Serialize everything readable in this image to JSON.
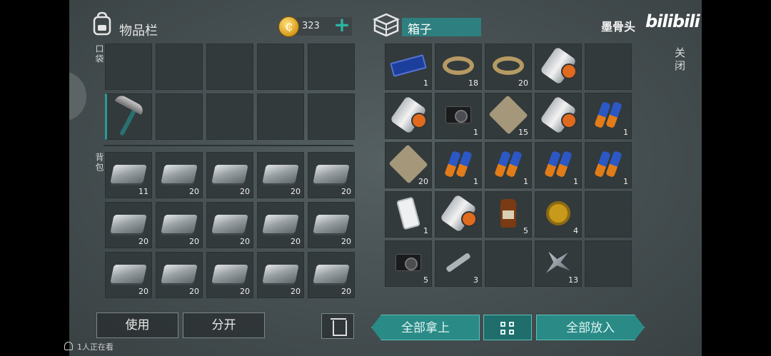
{
  "inventory": {
    "title": "物品栏",
    "coins": "323",
    "pocket_label": "口袋",
    "backpack_label": "背包",
    "pocket": [
      {
        "item": "",
        "count": ""
      },
      {
        "item": "",
        "count": ""
      },
      {
        "item": "",
        "count": ""
      },
      {
        "item": "",
        "count": ""
      },
      {
        "item": "",
        "count": ""
      },
      {
        "item": "pickaxe-icon",
        "count": ""
      },
      {
        "item": "",
        "count": ""
      },
      {
        "item": "",
        "count": ""
      },
      {
        "item": "",
        "count": ""
      },
      {
        "item": "",
        "count": ""
      }
    ],
    "backpack": [
      {
        "item": "iron-ingot-icon",
        "count": "11"
      },
      {
        "item": "iron-ingot-icon",
        "count": "20"
      },
      {
        "item": "iron-ingot-icon",
        "count": "20"
      },
      {
        "item": "iron-ingot-icon",
        "count": "20"
      },
      {
        "item": "iron-ingot-icon",
        "count": "20"
      },
      {
        "item": "iron-ingot-icon",
        "count": "20"
      },
      {
        "item": "iron-ingot-icon",
        "count": "20"
      },
      {
        "item": "iron-ingot-icon",
        "count": "20"
      },
      {
        "item": "iron-ingot-icon",
        "count": "20"
      },
      {
        "item": "iron-ingot-icon",
        "count": "20"
      },
      {
        "item": "iron-ingot-icon",
        "count": "20"
      },
      {
        "item": "iron-ingot-icon",
        "count": "20"
      },
      {
        "item": "iron-ingot-icon",
        "count": "20"
      },
      {
        "item": "iron-ingot-icon",
        "count": "20"
      },
      {
        "item": "iron-ingot-icon",
        "count": "20"
      }
    ]
  },
  "box": {
    "title": "箱子",
    "close_label": "关闭",
    "slots": [
      {
        "item": "circuit-board-icon",
        "count": "1"
      },
      {
        "item": "rope-icon",
        "count": "18"
      },
      {
        "item": "rope-icon",
        "count": "20"
      },
      {
        "item": "blueprint-tube-icon",
        "count": ""
      },
      {
        "item": "",
        "count": ""
      },
      {
        "item": "blueprint-tube-icon",
        "count": ""
      },
      {
        "item": "camera-icon",
        "count": "1"
      },
      {
        "item": "cloth-icon",
        "count": "15"
      },
      {
        "item": "blueprint-tube-icon",
        "count": ""
      },
      {
        "item": "battery-icon",
        "count": "1"
      },
      {
        "item": "cloth-icon",
        "count": "20"
      },
      {
        "item": "battery-icon",
        "count": "1"
      },
      {
        "item": "battery-icon",
        "count": "1"
      },
      {
        "item": "battery-icon",
        "count": "1"
      },
      {
        "item": "battery-icon",
        "count": "1"
      },
      {
        "item": "smartphone-icon",
        "count": "1"
      },
      {
        "item": "blueprint-tube-icon",
        "count": ""
      },
      {
        "item": "bottle-icon",
        "count": "5"
      },
      {
        "item": "gold-watch-icon",
        "count": "4"
      },
      {
        "item": "",
        "count": ""
      },
      {
        "item": "camera-icon",
        "count": "5"
      },
      {
        "item": "wrench-icon",
        "count": "3"
      },
      {
        "item": "",
        "count": ""
      },
      {
        "item": "scrap-metal-icon",
        "count": "13"
      },
      {
        "item": "",
        "count": ""
      }
    ]
  },
  "actions": {
    "use": "使用",
    "split": "分开",
    "take_all": "全部拿上",
    "put_all": "全部放入"
  },
  "overlay": {
    "uploader": "墨骨头",
    "watermark": "bilibili",
    "viewers": "1人正在看"
  }
}
